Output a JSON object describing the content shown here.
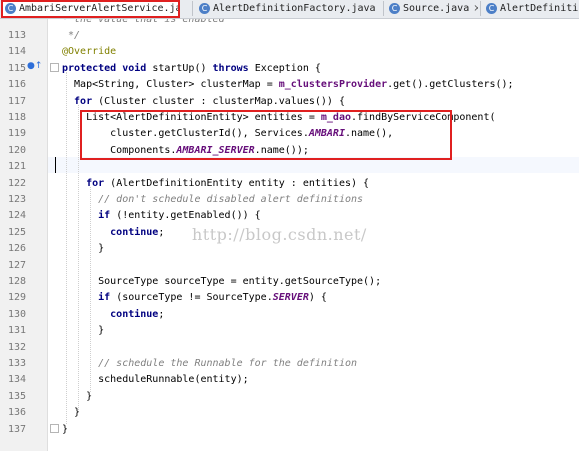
{
  "tabs": [
    {
      "label": "AmbariServerAlertService.java",
      "close": "×",
      "active": true
    },
    {
      "label": "AlertDefinitionFactory.java",
      "close": "×",
      "active": false
    },
    {
      "label": "Source.java",
      "close": "×",
      "active": false
    },
    {
      "label": "AlertDefiniti",
      "close": "",
      "active": false
    }
  ],
  "watermark": "http://blog.csdn.net/",
  "lines": [
    {
      "n": "113",
      "parts": [
        [
          "cm",
          " */"
        ]
      ]
    },
    {
      "n": "114",
      "parts": [
        [
          "ann",
          "@Override"
        ]
      ]
    },
    {
      "n": "115",
      "parts": [
        [
          "kw",
          "protected void "
        ],
        [
          "",
          "startUp() "
        ],
        [
          "kw",
          "throws "
        ],
        [
          "",
          "Exception {"
        ]
      ]
    },
    {
      "n": "116",
      "parts": [
        [
          "",
          "  Map<String, Cluster> clusterMap = "
        ],
        [
          "fld",
          "m_clustersProvider"
        ],
        [
          "",
          ".get().getClusters();"
        ]
      ]
    },
    {
      "n": "117",
      "parts": [
        [
          "kw",
          "  for "
        ],
        [
          "",
          "(Cluster cluster : clusterMap.values()) {"
        ]
      ]
    },
    {
      "n": "118",
      "parts": [
        [
          "",
          "    List<AlertDefinitionEntity> entities = "
        ],
        [
          "fld",
          "m_dao"
        ],
        [
          "",
          ".findByServiceComponent("
        ]
      ]
    },
    {
      "n": "119",
      "parts": [
        [
          "",
          "        cluster.getClusterId(), Services."
        ],
        [
          "sfld",
          "AMBARI"
        ],
        [
          "",
          ".name(),"
        ]
      ]
    },
    {
      "n": "120",
      "parts": [
        [
          "",
          "        Components."
        ],
        [
          "sfld",
          "AMBARI_SERVER"
        ],
        [
          "",
          ".name());"
        ]
      ]
    },
    {
      "n": "121",
      "parts": [
        [
          "",
          ""
        ]
      ]
    },
    {
      "n": "122",
      "parts": [
        [
          "kw",
          "    for "
        ],
        [
          "",
          "(AlertDefinitionEntity entity : entities) {"
        ]
      ]
    },
    {
      "n": "123",
      "parts": [
        [
          "cm",
          "      // don't schedule disabled alert definitions"
        ]
      ]
    },
    {
      "n": "124",
      "parts": [
        [
          "kw",
          "      if "
        ],
        [
          "",
          "(!entity.getEnabled()) {"
        ]
      ]
    },
    {
      "n": "125",
      "parts": [
        [
          "kw",
          "        continue"
        ],
        [
          "",
          ";"
        ]
      ]
    },
    {
      "n": "126",
      "parts": [
        [
          "",
          "      }"
        ]
      ]
    },
    {
      "n": "127",
      "parts": [
        [
          "",
          ""
        ]
      ]
    },
    {
      "n": "128",
      "parts": [
        [
          "",
          "      SourceType sourceType = entity.getSourceType();"
        ]
      ]
    },
    {
      "n": "129",
      "parts": [
        [
          "kw",
          "      if "
        ],
        [
          "",
          "(sourceType != SourceType."
        ],
        [
          "sfld",
          "SERVER"
        ],
        [
          "",
          ") {"
        ]
      ]
    },
    {
      "n": "130",
      "parts": [
        [
          "kw",
          "        continue"
        ],
        [
          "",
          ";"
        ]
      ]
    },
    {
      "n": "131",
      "parts": [
        [
          "",
          "      }"
        ]
      ]
    },
    {
      "n": "132",
      "parts": [
        [
          "",
          ""
        ]
      ]
    },
    {
      "n": "133",
      "parts": [
        [
          "cm",
          "      // schedule the Runnable for the definition"
        ]
      ]
    },
    {
      "n": "134",
      "parts": [
        [
          "",
          "      scheduleRunnable(entity);"
        ]
      ]
    },
    {
      "n": "135",
      "parts": [
        [
          "",
          "    }"
        ]
      ]
    },
    {
      "n": "136",
      "parts": [
        [
          "",
          "  }"
        ]
      ]
    },
    {
      "n": "137",
      "parts": [
        [
          "",
          "}"
        ]
      ]
    }
  ],
  "top_fragment": "   * the value that is enabled"
}
